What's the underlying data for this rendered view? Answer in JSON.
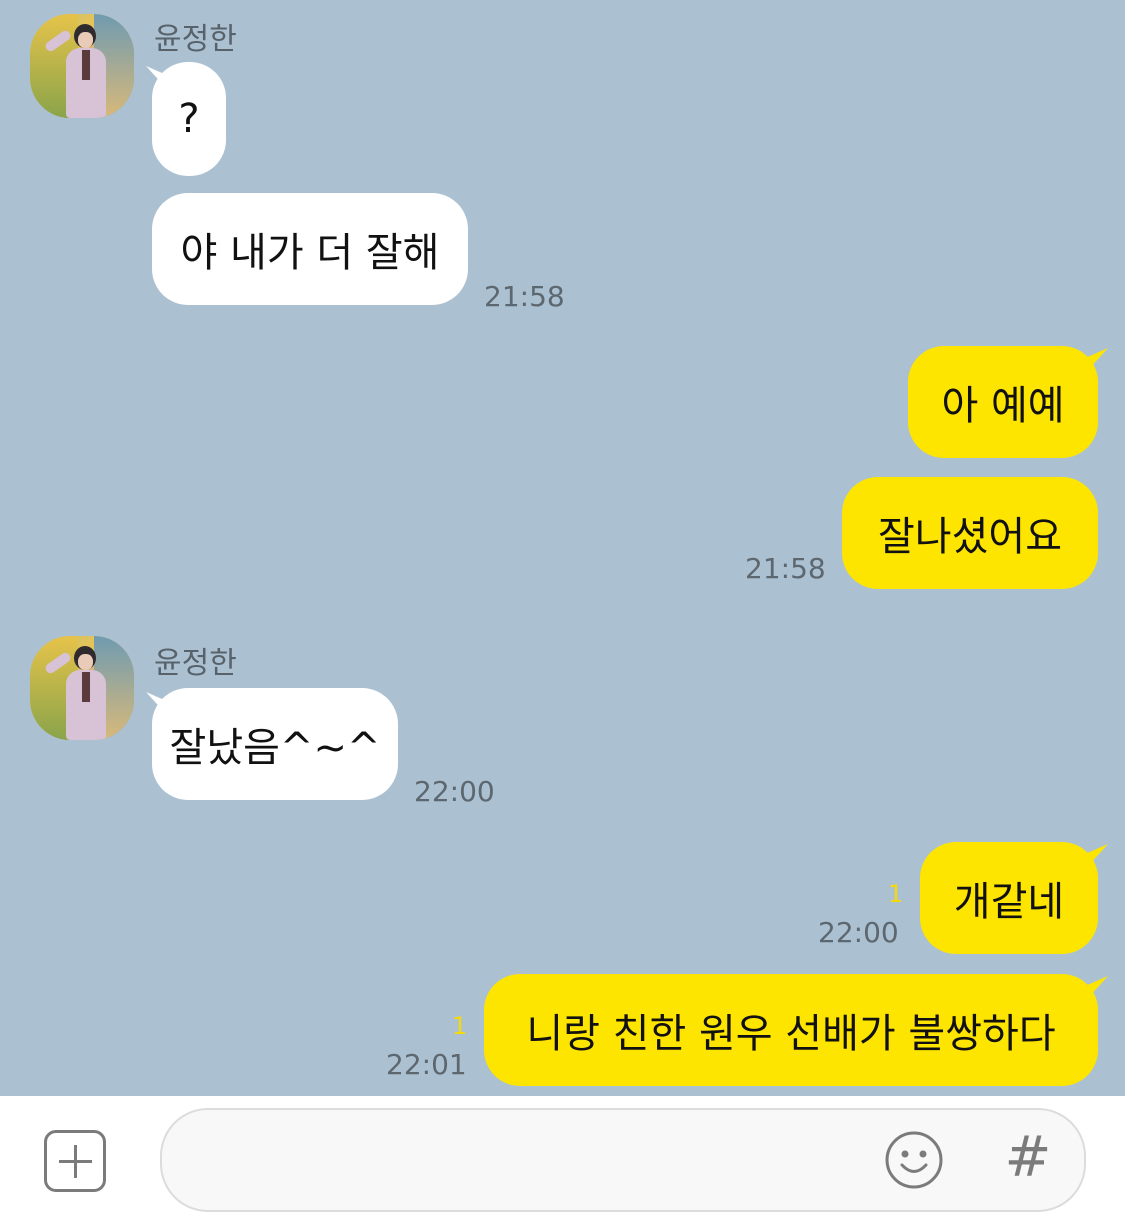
{
  "messages": [
    {
      "sender": "윤정한",
      "text": "?"
    },
    {
      "text": "야 내가 더 잘해",
      "time": "21:58"
    },
    {
      "text": "아 예예"
    },
    {
      "text": "잘나셨어요",
      "time": "21:58"
    },
    {
      "sender": "윤정한",
      "text": "잘났음^~^",
      "time": "22:00"
    },
    {
      "text": "개같네",
      "time": "22:00",
      "unread": "1"
    },
    {
      "text": "니랑 친한 원우 선배가 불쌍하다",
      "time": "22:01",
      "unread": "1"
    }
  ],
  "input_bar": {
    "placeholder": "",
    "hash_label": "#"
  },
  "icons": {
    "plus": "plus-icon",
    "emoji": "smile-emoji-icon",
    "hash": "hashtag-icon"
  },
  "colors": {
    "chat_background": "#abc1d1",
    "outgoing_bubble": "#fee500",
    "incoming_bubble": "#ffffff",
    "unread_count": "#f5d90a"
  }
}
